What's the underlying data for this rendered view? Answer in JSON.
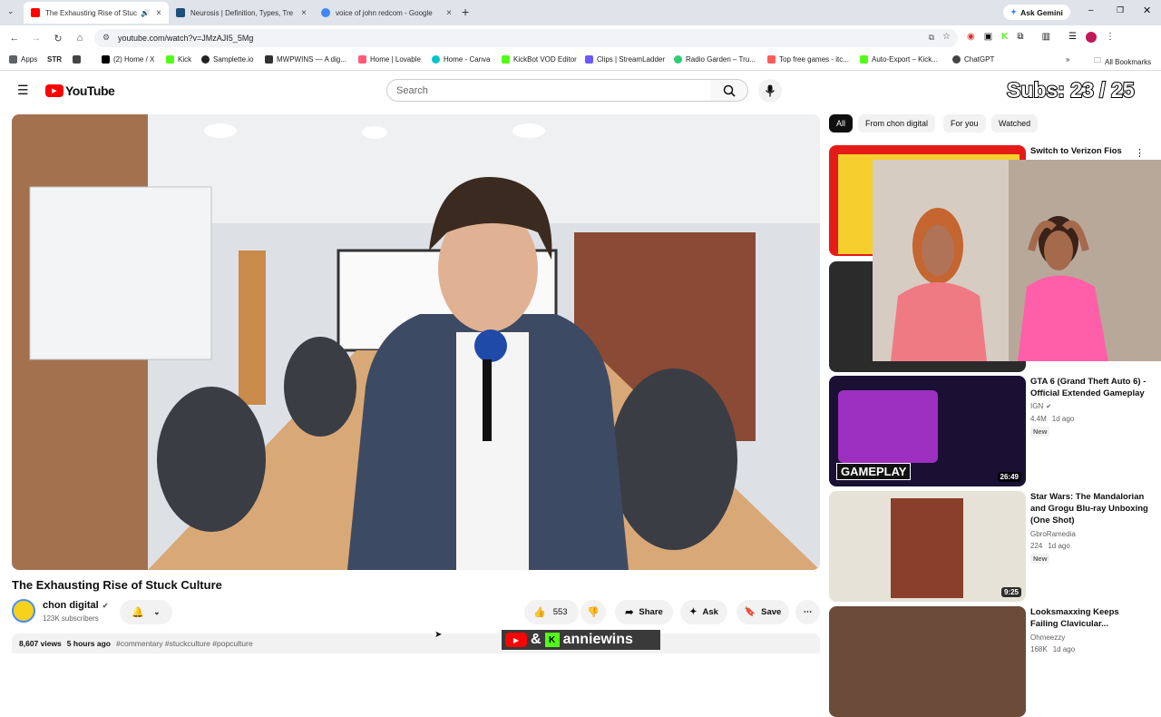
{
  "browser": {
    "tabs": [
      {
        "title": "The Exhausting Rise of Stuc",
        "active": true
      },
      {
        "title": "Neurosis | Definition, Types, Tre",
        "active": false
      },
      {
        "title": "voice of john redcom - Google",
        "active": false
      }
    ],
    "new_tab": "+",
    "ask_gemini": "Ask Gemini",
    "url": "youtube.com/watch?v=JMzAJI5_5Mg",
    "bookmarks": [
      "Apps",
      "STR",
      "(2) Home / X",
      "Kick",
      "Samplette.io",
      "MWPWINS — A dig...",
      "Home | Lovable",
      "Home - Canva",
      "KickBot VOD Editor",
      "Clips | StreamLadder",
      "Radio Garden – Tru...",
      "Top free games - itc...",
      "Auto-Export – Kick...",
      "ChatGPT"
    ],
    "all_bookmarks": "All Bookmarks"
  },
  "youtube": {
    "logo_text": "YouTube",
    "search_placeholder": "Search",
    "subs_overlay": "Subs: 23 / 25",
    "filters": [
      "All",
      "From chon digital",
      "For you",
      "Watched"
    ],
    "video": {
      "title": "The Exhausting Rise of Stuck Culture",
      "channel": "chon digital",
      "subscribers": "123K subscribers",
      "likes": "553",
      "share": "Share",
      "ask": "Ask",
      "save": "Save",
      "views": "8,607 views",
      "age": "5 hours ago",
      "hashtags": "#commentary #stuckculture #popculture"
    },
    "recommended": [
      {
        "title": "Switch to Verizon Fios"
      },
      {
        "title": "GTA 6 (Grand Theft Auto 6) - Official Extended Gameplay",
        "channel": "IGN",
        "views": "4.4M",
        "age": "1d ago",
        "badge": "New",
        "duration": "26:49",
        "thumb_text": "GAMEPLAY"
      },
      {
        "title": "Star Wars: The Mandalorian and Grogu Blu-ray Unboxing (One Shot)",
        "channel": "GbroRamedia",
        "views": "224",
        "age": "1d ago",
        "badge": "New",
        "duration": "9:25"
      },
      {
        "title": "Looksmaxxing Keeps Failing Clavicular...",
        "channel": "Ohmeezzy",
        "views": "168K",
        "age": "1d ago"
      }
    ],
    "stream_handle": "anniewins",
    "stream_amp": "&"
  },
  "colors": {
    "yt_red": "#ff0000",
    "chrome_bg": "#dfe3ea",
    "kick_green": "#53fc18"
  }
}
